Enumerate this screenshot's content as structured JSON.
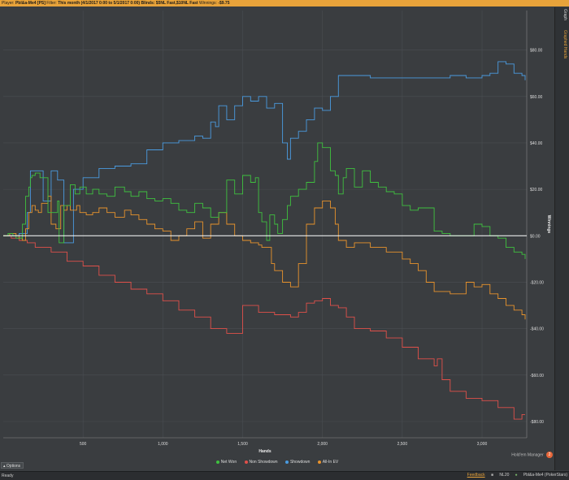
{
  "header": {
    "player_label": "Player:",
    "player_value": "Pbl&a-Me4 [PS]",
    "filter_label": "Filter:",
    "filter_value": "This month (4/1/2017 0:00 to 5/1/2017 0:00) Blinds: $5NL Fast,$10NL Fast",
    "winnings_label": "Winnings:",
    "winnings_value": "-$9.75"
  },
  "sidetabs": {
    "graph": "Graph",
    "graphed_hands": "Graphed Hands"
  },
  "chart_data": {
    "type": "line",
    "xlabel": "Hands",
    "ylabel": "Winnings",
    "xlim": [
      0,
      3280
    ],
    "ylim": [
      -87,
      97
    ],
    "x_ticks": [
      500,
      1000,
      1500,
      2000,
      2500,
      3000
    ],
    "x_tick_labels": [
      "500",
      "1,000",
      "1,500",
      "2,000",
      "2,500",
      "3,000"
    ],
    "y_ticks": [
      80,
      60,
      40,
      20,
      0,
      -20,
      -40,
      -60,
      -80
    ],
    "y_tick_labels": [
      "$80.00",
      "$60.00",
      "$40.00",
      "$20.00",
      "$0.00",
      "-$20.00",
      "-$40.00",
      "-$60.00",
      "-$80.00"
    ],
    "series": [
      {
        "name": "Net Won",
        "color": "#3fc13f",
        "x": [
          0,
          30,
          60,
          80,
          100,
          120,
          140,
          160,
          170,
          180,
          200,
          230,
          280,
          340,
          350,
          380,
          420,
          450,
          480,
          520,
          560,
          600,
          650,
          700,
          760,
          800,
          850,
          900,
          950,
          1000,
          1050,
          1100,
          1150,
          1200,
          1250,
          1300,
          1350,
          1400,
          1450,
          1500,
          1550,
          1580,
          1600,
          1620,
          1650,
          1670,
          1700,
          1720,
          1750,
          1780,
          1800,
          1850,
          1900,
          1950,
          1970,
          2000,
          2050,
          2080,
          2100,
          2130,
          2150,
          2200,
          2250,
          2300,
          2350,
          2400,
          2450,
          2500,
          2550,
          2600,
          2700,
          2750,
          2800,
          2900,
          2950,
          3000,
          3050,
          3100,
          3150,
          3200,
          3250,
          3270
        ],
        "y": [
          0,
          1,
          0,
          -1,
          -1,
          5,
          17,
          21,
          25,
          26,
          27,
          25,
          10,
          15,
          -3,
          13,
          22,
          18,
          21,
          18,
          20,
          18,
          17,
          21,
          19,
          17,
          19,
          16,
          15,
          16,
          14,
          11,
          10,
          14,
          12,
          8,
          10,
          24,
          18,
          26,
          23,
          25,
          10,
          6,
          -2,
          9,
          5,
          1,
          7,
          13,
          17,
          20,
          23,
          32,
          40,
          38,
          28,
          26,
          18,
          25,
          29,
          21,
          28,
          23,
          21,
          19,
          18,
          13,
          11,
          12,
          2,
          1,
          0,
          0,
          5,
          4,
          0,
          -1,
          -5,
          -7,
          -8,
          -10
        ]
      },
      {
        "name": "Non Showdown",
        "color": "#e0504a",
        "x": [
          0,
          50,
          100,
          150,
          200,
          300,
          400,
          500,
          600,
          700,
          800,
          900,
          1000,
          1100,
          1200,
          1300,
          1400,
          1500,
          1600,
          1700,
          1800,
          1850,
          1900,
          1950,
          2000,
          2050,
          2100,
          2150,
          2200,
          2300,
          2400,
          2500,
          2600,
          2700,
          2720,
          2750,
          2800,
          2900,
          3000,
          3100,
          3200,
          3250,
          3270
        ],
        "y": [
          0,
          -1,
          -2,
          -3,
          -5,
          -7,
          -11,
          -13,
          -17,
          -20,
          -23,
          -25,
          -28,
          -32,
          -35,
          -40,
          -42,
          -30,
          -33,
          -34,
          -35,
          -33,
          -29,
          -28,
          -27,
          -30,
          -31,
          -35,
          -40,
          -41,
          -44,
          -48,
          -53,
          -56,
          -53,
          -62,
          -67,
          -70,
          -71,
          -74,
          -79,
          -77,
          -77
        ]
      },
      {
        "name": "Showdown",
        "color": "#4a9be0",
        "x": [
          0,
          50,
          100,
          150,
          170,
          200,
          250,
          300,
          340,
          380,
          440,
          500,
          600,
          700,
          800,
          900,
          1000,
          1100,
          1200,
          1250,
          1300,
          1330,
          1350,
          1400,
          1450,
          1500,
          1550,
          1600,
          1650,
          1700,
          1750,
          1780,
          1800,
          1850,
          1900,
          1950,
          2000,
          2050,
          2100,
          2200,
          2300,
          2400,
          2600,
          2800,
          2900,
          3000,
          3050,
          3100,
          3150,
          3200,
          3250,
          3270
        ],
        "y": [
          0,
          0,
          1,
          10,
          28,
          28,
          15,
          28,
          24,
          -3,
          20,
          25,
          29,
          30,
          31,
          37,
          40,
          41,
          43,
          42,
          49,
          47,
          56,
          50,
          56,
          60,
          58,
          60,
          55,
          57,
          40,
          33,
          42,
          45,
          50,
          55,
          54,
          60,
          69,
          69,
          68,
          68,
          68,
          69,
          68,
          69,
          70,
          75,
          74,
          70,
          69,
          67
        ]
      },
      {
        "name": "All-in EV",
        "color": "#e8932c",
        "x": [
          0,
          40,
          80,
          100,
          120,
          140,
          160,
          180,
          200,
          220,
          240,
          280,
          300,
          330,
          360,
          380,
          400,
          420,
          460,
          480,
          520,
          560,
          600,
          650,
          700,
          760,
          800,
          850,
          900,
          950,
          1000,
          1050,
          1100,
          1150,
          1200,
          1250,
          1300,
          1350,
          1400,
          1450,
          1500,
          1550,
          1600,
          1620,
          1650,
          1680,
          1700,
          1750,
          1800,
          1850,
          1900,
          1950,
          2000,
          2050,
          2080,
          2100,
          2150,
          2200,
          2300,
          2400,
          2500,
          2550,
          2600,
          2650,
          2700,
          2800,
          2900,
          2950,
          3000,
          3050,
          3100,
          3150,
          3200,
          3250,
          3270
        ],
        "y": [
          0,
          1,
          0,
          -1,
          -2,
          3,
          10,
          13,
          11,
          10,
          14,
          17,
          5,
          3,
          13,
          11,
          13,
          11,
          13,
          10,
          9,
          10,
          12,
          10,
          8,
          11,
          9,
          7,
          5,
          3,
          2,
          -2,
          0,
          3,
          6,
          -1,
          5,
          10,
          5,
          0,
          -2,
          -3,
          -4,
          -5,
          -5,
          -12,
          -15,
          -20,
          -22,
          -12,
          5,
          12,
          15,
          12,
          5,
          -2,
          -5,
          -3,
          -5,
          -7,
          -10,
          -12,
          -15,
          -20,
          -24,
          -25,
          -20,
          -22,
          -21,
          -25,
          -27,
          -30,
          -32,
          -34,
          -36
        ]
      }
    ],
    "legend_position": "bottom",
    "grid": true
  },
  "legend": [
    {
      "label": "Net Won",
      "color": "#3fc13f"
    },
    {
      "label": "Non Showdown",
      "color": "#e0504a"
    },
    {
      "label": "Showdown",
      "color": "#4a9be0"
    },
    {
      "label": "All-In EV",
      "color": "#e8932c"
    }
  ],
  "branding": {
    "powered_by": "Powered by",
    "name": "Hold'em Manager",
    "badge": "2"
  },
  "options_label": "Options",
  "status": {
    "ready": "Ready",
    "feedback": "Feedback",
    "stake": "NL20",
    "account": "Pbl&a-Me4 (PokerStars)"
  }
}
